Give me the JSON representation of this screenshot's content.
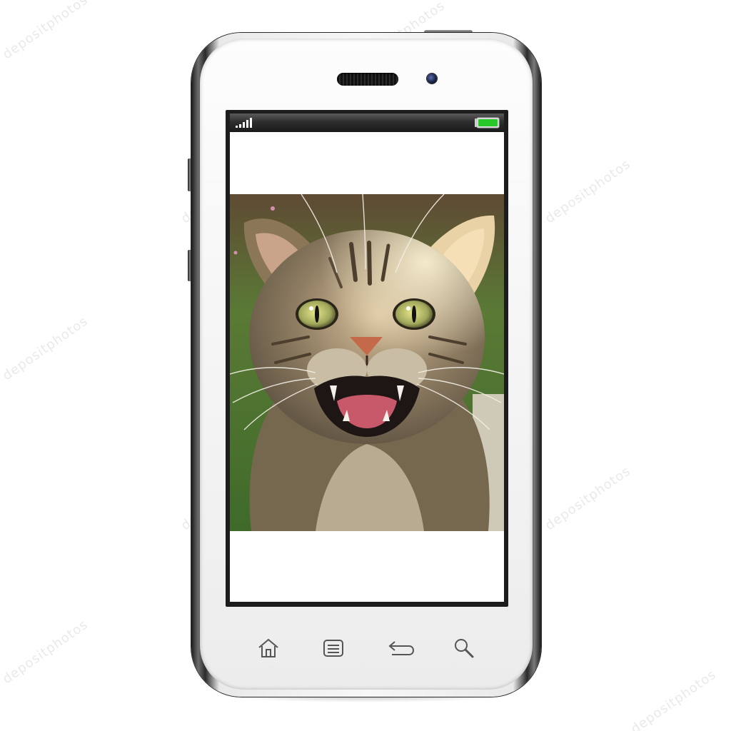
{
  "device": {
    "type": "smartphone",
    "frame_color": "#f4f4f4",
    "edge_color": "#1b1b1b"
  },
  "status_bar": {
    "signal_icon": "signal-bars-icon",
    "battery_icon": "battery-icon",
    "battery_color": "#28c828",
    "battery_level": 1.0
  },
  "screen": {
    "background": "#ffffff",
    "content": "photo-of-hissing-tabby-cat"
  },
  "nav_buttons": [
    {
      "name": "home-button",
      "icon": "home-icon"
    },
    {
      "name": "menu-button",
      "icon": "menu-icon"
    },
    {
      "name": "back-button",
      "icon": "back-arrow-icon"
    },
    {
      "name": "search-button",
      "icon": "search-icon"
    }
  ],
  "watermark": {
    "text": "depositphotos"
  }
}
